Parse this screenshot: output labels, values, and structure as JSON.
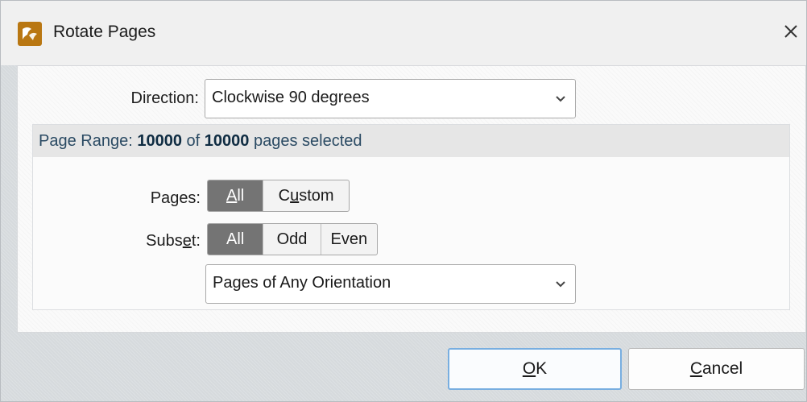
{
  "window": {
    "title": "Rotate Pages",
    "icon": "app-logo-icon",
    "close_icon": "close-icon"
  },
  "direction": {
    "label": "Direction:",
    "selected": "Clockwise 90 degrees"
  },
  "page_range": {
    "prefix": "Page Range:",
    "selected_count": "10000",
    "of": "of",
    "total_count": "10000",
    "suffix": "pages selected"
  },
  "pages": {
    "label_pre": "Pa",
    "label_mn": "g",
    "label_post": "es:",
    "options": [
      {
        "label_mn": "A",
        "label_post": "ll",
        "active": true
      },
      {
        "label_pre": "C",
        "label_mn": "u",
        "label_post": "stom",
        "active": false
      }
    ]
  },
  "subset": {
    "label_pre": "Subs",
    "label_mn": "e",
    "label_post": "t:",
    "options": [
      {
        "label": "All",
        "active": true
      },
      {
        "label": "Odd",
        "active": false
      },
      {
        "label": "Even",
        "active": false
      }
    ]
  },
  "orientation": {
    "selected": "Pages of Any Orientation"
  },
  "buttons": {
    "ok_mn": "O",
    "ok_post": "K",
    "cancel_mn": "C",
    "cancel_post": "ancel"
  },
  "colors": {
    "accent_border": "#78aee0",
    "active_segment": "#747474",
    "app_icon": "#b97712"
  }
}
